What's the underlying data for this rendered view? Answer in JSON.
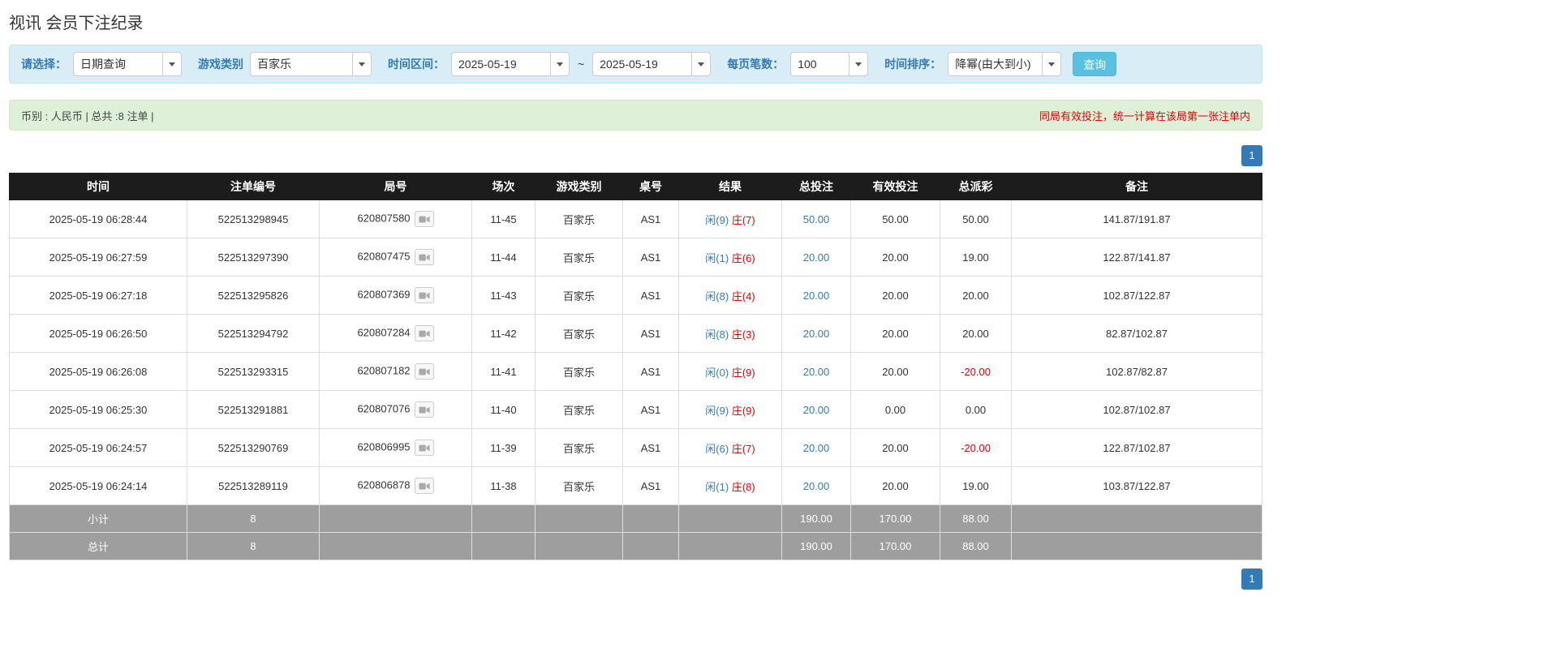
{
  "page": {
    "title": "视讯 会员下注纪录"
  },
  "colors": {
    "accent_blue": "#337ab7",
    "banker_red": "#e60000",
    "filter_bg": "#d9edf7",
    "summary_bg": "#dff0d8",
    "header_bg": "#1c1c1c",
    "footer_bg": "#9e9e9e",
    "search_button_bg": "#5bc0de"
  },
  "filters": {
    "select_label": "请选择：",
    "select_value": "日期查询",
    "game_type_label": "游戏类别",
    "game_type_value": "百家乐",
    "time_range_label": "时间区间：",
    "date_from": "2025-05-19",
    "tilde": "~",
    "date_to": "2025-05-19",
    "page_size_label": "每页笔数：",
    "page_size_value": "100",
    "sort_label": "时间排序：",
    "sort_value": "降幂(由大到小)",
    "search_button": "查询"
  },
  "summary": {
    "left": "币别 : 人民币 | 总共 :8 注单 |",
    "right": "同局有效投注，统一计算在该局第一张注单内"
  },
  "pagination": {
    "page": "1"
  },
  "table": {
    "headers": [
      "时间",
      "注单编号",
      "局号",
      "场次",
      "游戏类别",
      "桌号",
      "结果",
      "总投注",
      "有效投注",
      "总派彩",
      "备注"
    ],
    "rows": [
      {
        "time": "2025-05-19 06:28:44",
        "bet_id": "522513298945",
        "round_id": "620807580",
        "session": "11-45",
        "game": "百家乐",
        "table_no": "AS1",
        "result_player": "闲(9)",
        "result_banker": "庄(7)",
        "total_bet": "50.00",
        "valid_bet": "50.00",
        "payout": "50.00",
        "note": "141.87/191.87"
      },
      {
        "time": "2025-05-19 06:27:59",
        "bet_id": "522513297390",
        "round_id": "620807475",
        "session": "11-44",
        "game": "百家乐",
        "table_no": "AS1",
        "result_player": "闲(1)",
        "result_banker": "庄(6)",
        "total_bet": "20.00",
        "valid_bet": "20.00",
        "payout": "19.00",
        "note": "122.87/141.87"
      },
      {
        "time": "2025-05-19 06:27:18",
        "bet_id": "522513295826",
        "round_id": "620807369",
        "session": "11-43",
        "game": "百家乐",
        "table_no": "AS1",
        "result_player": "闲(8)",
        "result_banker": "庄(4)",
        "total_bet": "20.00",
        "valid_bet": "20.00",
        "payout": "20.00",
        "note": "102.87/122.87"
      },
      {
        "time": "2025-05-19 06:26:50",
        "bet_id": "522513294792",
        "round_id": "620807284",
        "session": "11-42",
        "game": "百家乐",
        "table_no": "AS1",
        "result_player": "闲(8)",
        "result_banker": "庄(3)",
        "total_bet": "20.00",
        "valid_bet": "20.00",
        "payout": "20.00",
        "note": "82.87/102.87"
      },
      {
        "time": "2025-05-19 06:26:08",
        "bet_id": "522513293315",
        "round_id": "620807182",
        "session": "11-41",
        "game": "百家乐",
        "table_no": "AS1",
        "result_player": "闲(0)",
        "result_banker": "庄(9)",
        "total_bet": "20.00",
        "valid_bet": "20.00",
        "payout": "-20.00",
        "note": "102.87/82.87"
      },
      {
        "time": "2025-05-19 06:25:30",
        "bet_id": "522513291881",
        "round_id": "620807076",
        "session": "11-40",
        "game": "百家乐",
        "table_no": "AS1",
        "result_player": "闲(9)",
        "result_banker": "庄(9)",
        "total_bet": "20.00",
        "valid_bet": "0.00",
        "payout": "0.00",
        "note": "102.87/102.87"
      },
      {
        "time": "2025-05-19 06:24:57",
        "bet_id": "522513290769",
        "round_id": "620806995",
        "session": "11-39",
        "game": "百家乐",
        "table_no": "AS1",
        "result_player": "闲(6)",
        "result_banker": "庄(7)",
        "total_bet": "20.00",
        "valid_bet": "20.00",
        "payout": "-20.00",
        "note": "122.87/102.87"
      },
      {
        "time": "2025-05-19 06:24:14",
        "bet_id": "522513289119",
        "round_id": "620806878",
        "session": "11-38",
        "game": "百家乐",
        "table_no": "AS1",
        "result_player": "闲(1)",
        "result_banker": "庄(8)",
        "total_bet": "20.00",
        "valid_bet": "20.00",
        "payout": "19.00",
        "note": "103.87/122.87"
      }
    ],
    "subtotal": {
      "label": "小计",
      "count": "8",
      "total_bet": "190.00",
      "valid_bet": "170.00",
      "payout": "88.00"
    },
    "total": {
      "label": "总计",
      "count": "8",
      "total_bet": "190.00",
      "valid_bet": "170.00",
      "payout": "88.00"
    }
  }
}
